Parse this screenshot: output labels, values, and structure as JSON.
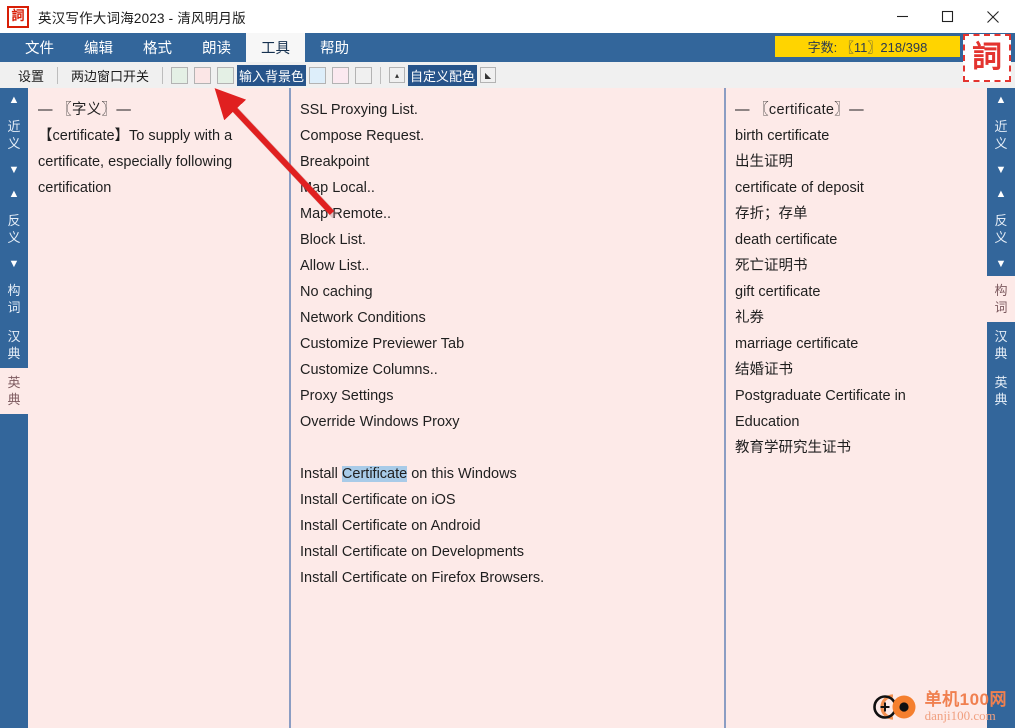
{
  "window": {
    "title": "英汉写作大词海2023 - 清风明月版",
    "app_icon": "詞",
    "minimize_label": "minimize",
    "maximize_label": "maximize",
    "close_label": "close"
  },
  "menu": {
    "items": [
      {
        "label": "文件",
        "active": false
      },
      {
        "label": "编辑",
        "active": false
      },
      {
        "label": "格式",
        "active": false
      },
      {
        "label": "朗读",
        "active": false
      },
      {
        "label": "工具",
        "active": true
      },
      {
        "label": "帮助",
        "active": false
      }
    ],
    "wordcount": "字数: 〖11〗218/398",
    "seal_char": "詞"
  },
  "toolbar": {
    "settings_label": "设置",
    "dual_window_label": "两边窗口开关",
    "swatches_group1": [
      "#e4f0e5",
      "#fbe6e6",
      "#e4f0e5"
    ],
    "input_bg_label": "输入背景色",
    "swatches_group2": [
      "#ddeefa",
      "#fbe9f0",
      "#f0f0f0"
    ],
    "dropdown_icon": "▴",
    "custom_color_label": "自定义配色",
    "resize_icon": "◣"
  },
  "sidebar_left": {
    "items": [
      {
        "kind": "arrow",
        "label": "▲",
        "name": "scroll-up-synonym",
        "active": false
      },
      {
        "kind": "word",
        "label": "近义",
        "name": "synonym",
        "active": false
      },
      {
        "kind": "arrow",
        "label": "▼",
        "name": "scroll-down-synonym",
        "active": false
      },
      {
        "kind": "arrow",
        "label": "▲",
        "name": "scroll-up-antonym",
        "active": false
      },
      {
        "kind": "word",
        "label": "反义",
        "name": "antonym",
        "active": false
      },
      {
        "kind": "arrow",
        "label": "▼",
        "name": "scroll-down-antonym",
        "active": false
      },
      {
        "kind": "word",
        "label": "构词",
        "name": "word-formation",
        "active": false
      },
      {
        "kind": "word",
        "label": "汉典",
        "name": "chinese-dictionary",
        "active": false
      },
      {
        "kind": "word",
        "label": "英典",
        "name": "english-dictionary",
        "active": true
      }
    ]
  },
  "sidebar_right": {
    "items": [
      {
        "kind": "arrow",
        "label": "▲",
        "name": "scroll-up-synonym",
        "active": false
      },
      {
        "kind": "word",
        "label": "近义",
        "name": "synonym",
        "active": false
      },
      {
        "kind": "arrow",
        "label": "▼",
        "name": "scroll-down-synonym",
        "active": false
      },
      {
        "kind": "arrow",
        "label": "▲",
        "name": "scroll-up-antonym",
        "active": false
      },
      {
        "kind": "word",
        "label": "反义",
        "name": "antonym",
        "active": false
      },
      {
        "kind": "arrow",
        "label": "▼",
        "name": "scroll-down-antonym",
        "active": false
      },
      {
        "kind": "word",
        "label": "构词",
        "name": "word-formation",
        "active": true
      },
      {
        "kind": "word",
        "label": "汉典",
        "name": "chinese-dictionary",
        "active": false
      },
      {
        "kind": "word",
        "label": "英典",
        "name": "english-dictionary",
        "active": false
      }
    ]
  },
  "panel_left": {
    "heading": "— 〖字义〗—",
    "body": "【certificate】To supply with a certificate, especially following certification"
  },
  "panel_mid": {
    "lines": [
      "SSL Proxying List.",
      "Compose Request.",
      "Breakpoint",
      "Map Local..",
      "Map Remote..",
      "Block List.",
      "Allow List..",
      "No caching",
      "Network Conditions",
      "Customize Previewer Tab",
      "Customize Columns..",
      "Proxy Settings",
      "Override Windows Proxy",
      "",
      "Install Certificate on this Windows",
      "Install Certificate on iOS",
      "Install Certificate on Android",
      "Install Certificate on Developments",
      "Install Certificate on Firefox Browsers."
    ],
    "selection": {
      "line_index": 14,
      "prefix": "Install ",
      "selected": "Certificate",
      "suffix": " on this Windows"
    }
  },
  "panel_right": {
    "heading": "— 〖certificate〗—",
    "lines": [
      "birth certificate",
      "出生证明",
      "certificate of deposit",
      "存折；存单",
      "death certificate",
      "死亡证明书",
      "gift certificate",
      "礼券",
      "marriage certificate",
      "结婚证书",
      "Postgraduate Certificate in",
      "Education",
      "教育学研究生证书"
    ]
  },
  "watermark": {
    "cn": "单机100网",
    "en": "danji100.com"
  },
  "colors": {
    "chrome_blue": "#33669b",
    "panel_bg": "#fdeae8",
    "accent_yellow": "#ffd400",
    "selection_blue": "#a8cbe8",
    "annotation_red": "#e02020",
    "divider": "#8b9dc3"
  }
}
